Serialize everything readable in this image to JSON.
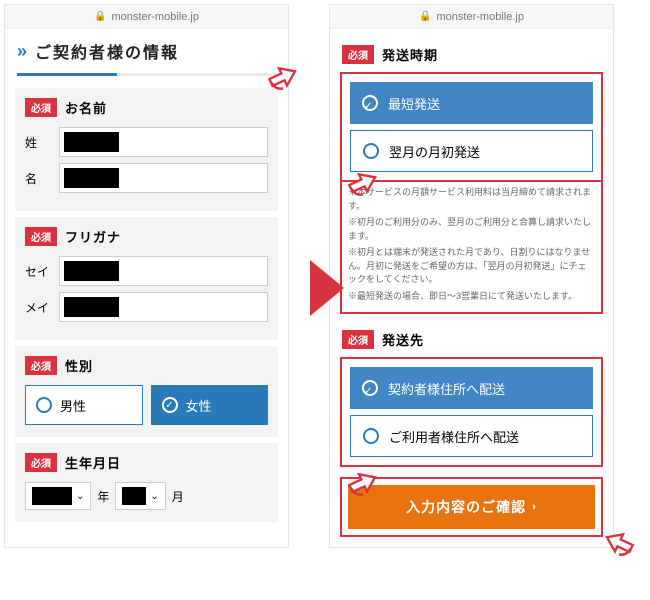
{
  "url": "monster-mobile.jp",
  "left": {
    "sectionTitle": "ご契約者様の情報",
    "required": "必須",
    "name": {
      "label": "お名前",
      "sei": "姓",
      "mei": "名"
    },
    "kana": {
      "label": "フリガナ",
      "sei": "セイ",
      "mei": "メイ"
    },
    "gender": {
      "label": "性別",
      "male": "男性",
      "female": "女性"
    },
    "dob": {
      "label": "生年月日",
      "year": "年",
      "month": "月"
    }
  },
  "right": {
    "required": "必須",
    "ship": {
      "label": "発送時期",
      "opt1": "最短発送",
      "opt2": "翌月の月初発送",
      "notes": [
        "※本サービスの月額サービス利用料は当月締めて請求されます。",
        "※初月のご利用分のみ、翌月のご利用分と合算し請求いたします。",
        "※初月とは端末が発送された月であり、日割りにはなりません。月初に発送をご希望の方は、「翌月の月初発送」にチェックをしてください。",
        "※最短発送の場合、即日～3営業日にて発送いたします。"
      ]
    },
    "dest": {
      "label": "発送先",
      "opt1": "契約者様住所へ配送",
      "opt2": "ご利用者様住所へ配送"
    },
    "submit": "入力内容のご確認"
  }
}
